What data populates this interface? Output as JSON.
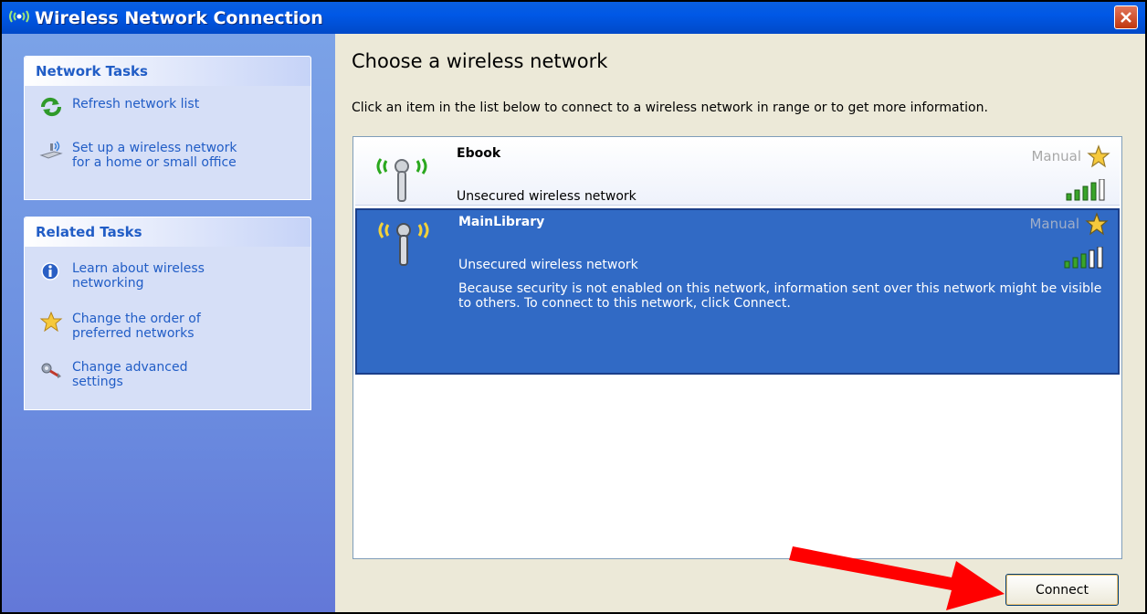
{
  "window": {
    "title": "Wireless Network Connection"
  },
  "sidebar": {
    "network_tasks": {
      "header": "Network Tasks",
      "items": [
        {
          "label": "Refresh network list",
          "icon": "refresh-icon"
        },
        {
          "label": "Set up a wireless network\nfor a home or small office",
          "icon": "wireless-setup-icon"
        }
      ]
    },
    "related_tasks": {
      "header": "Related Tasks",
      "items": [
        {
          "label": "Learn about wireless\nnetworking",
          "icon": "info-icon"
        },
        {
          "label": "Change the order of\npreferred networks",
          "icon": "star-icon"
        },
        {
          "label": "Change advanced\nsettings",
          "icon": "settings-icon"
        }
      ]
    }
  },
  "main": {
    "heading": "Choose a wireless network",
    "description": "Click an item in the list below to connect to a wireless network in range or to get more information.",
    "networks": [
      {
        "name": "Ebook",
        "status": "Unsecured wireless network",
        "type": "Manual",
        "selected": false
      },
      {
        "name": "MainLibrary",
        "status": "Unsecured wireless network",
        "type": "Manual",
        "selected": true,
        "warning": "Because security is not enabled on this network, information sent over this network might be visible to others. To connect to this network, click Connect."
      }
    ],
    "connect_label": "Connect"
  },
  "colors": {
    "titlebar": "#0058e6",
    "sidebar": "#6b8ee0",
    "selection": "#316ac5",
    "link": "#215dc6",
    "annotation_arrow": "#ff0000"
  }
}
